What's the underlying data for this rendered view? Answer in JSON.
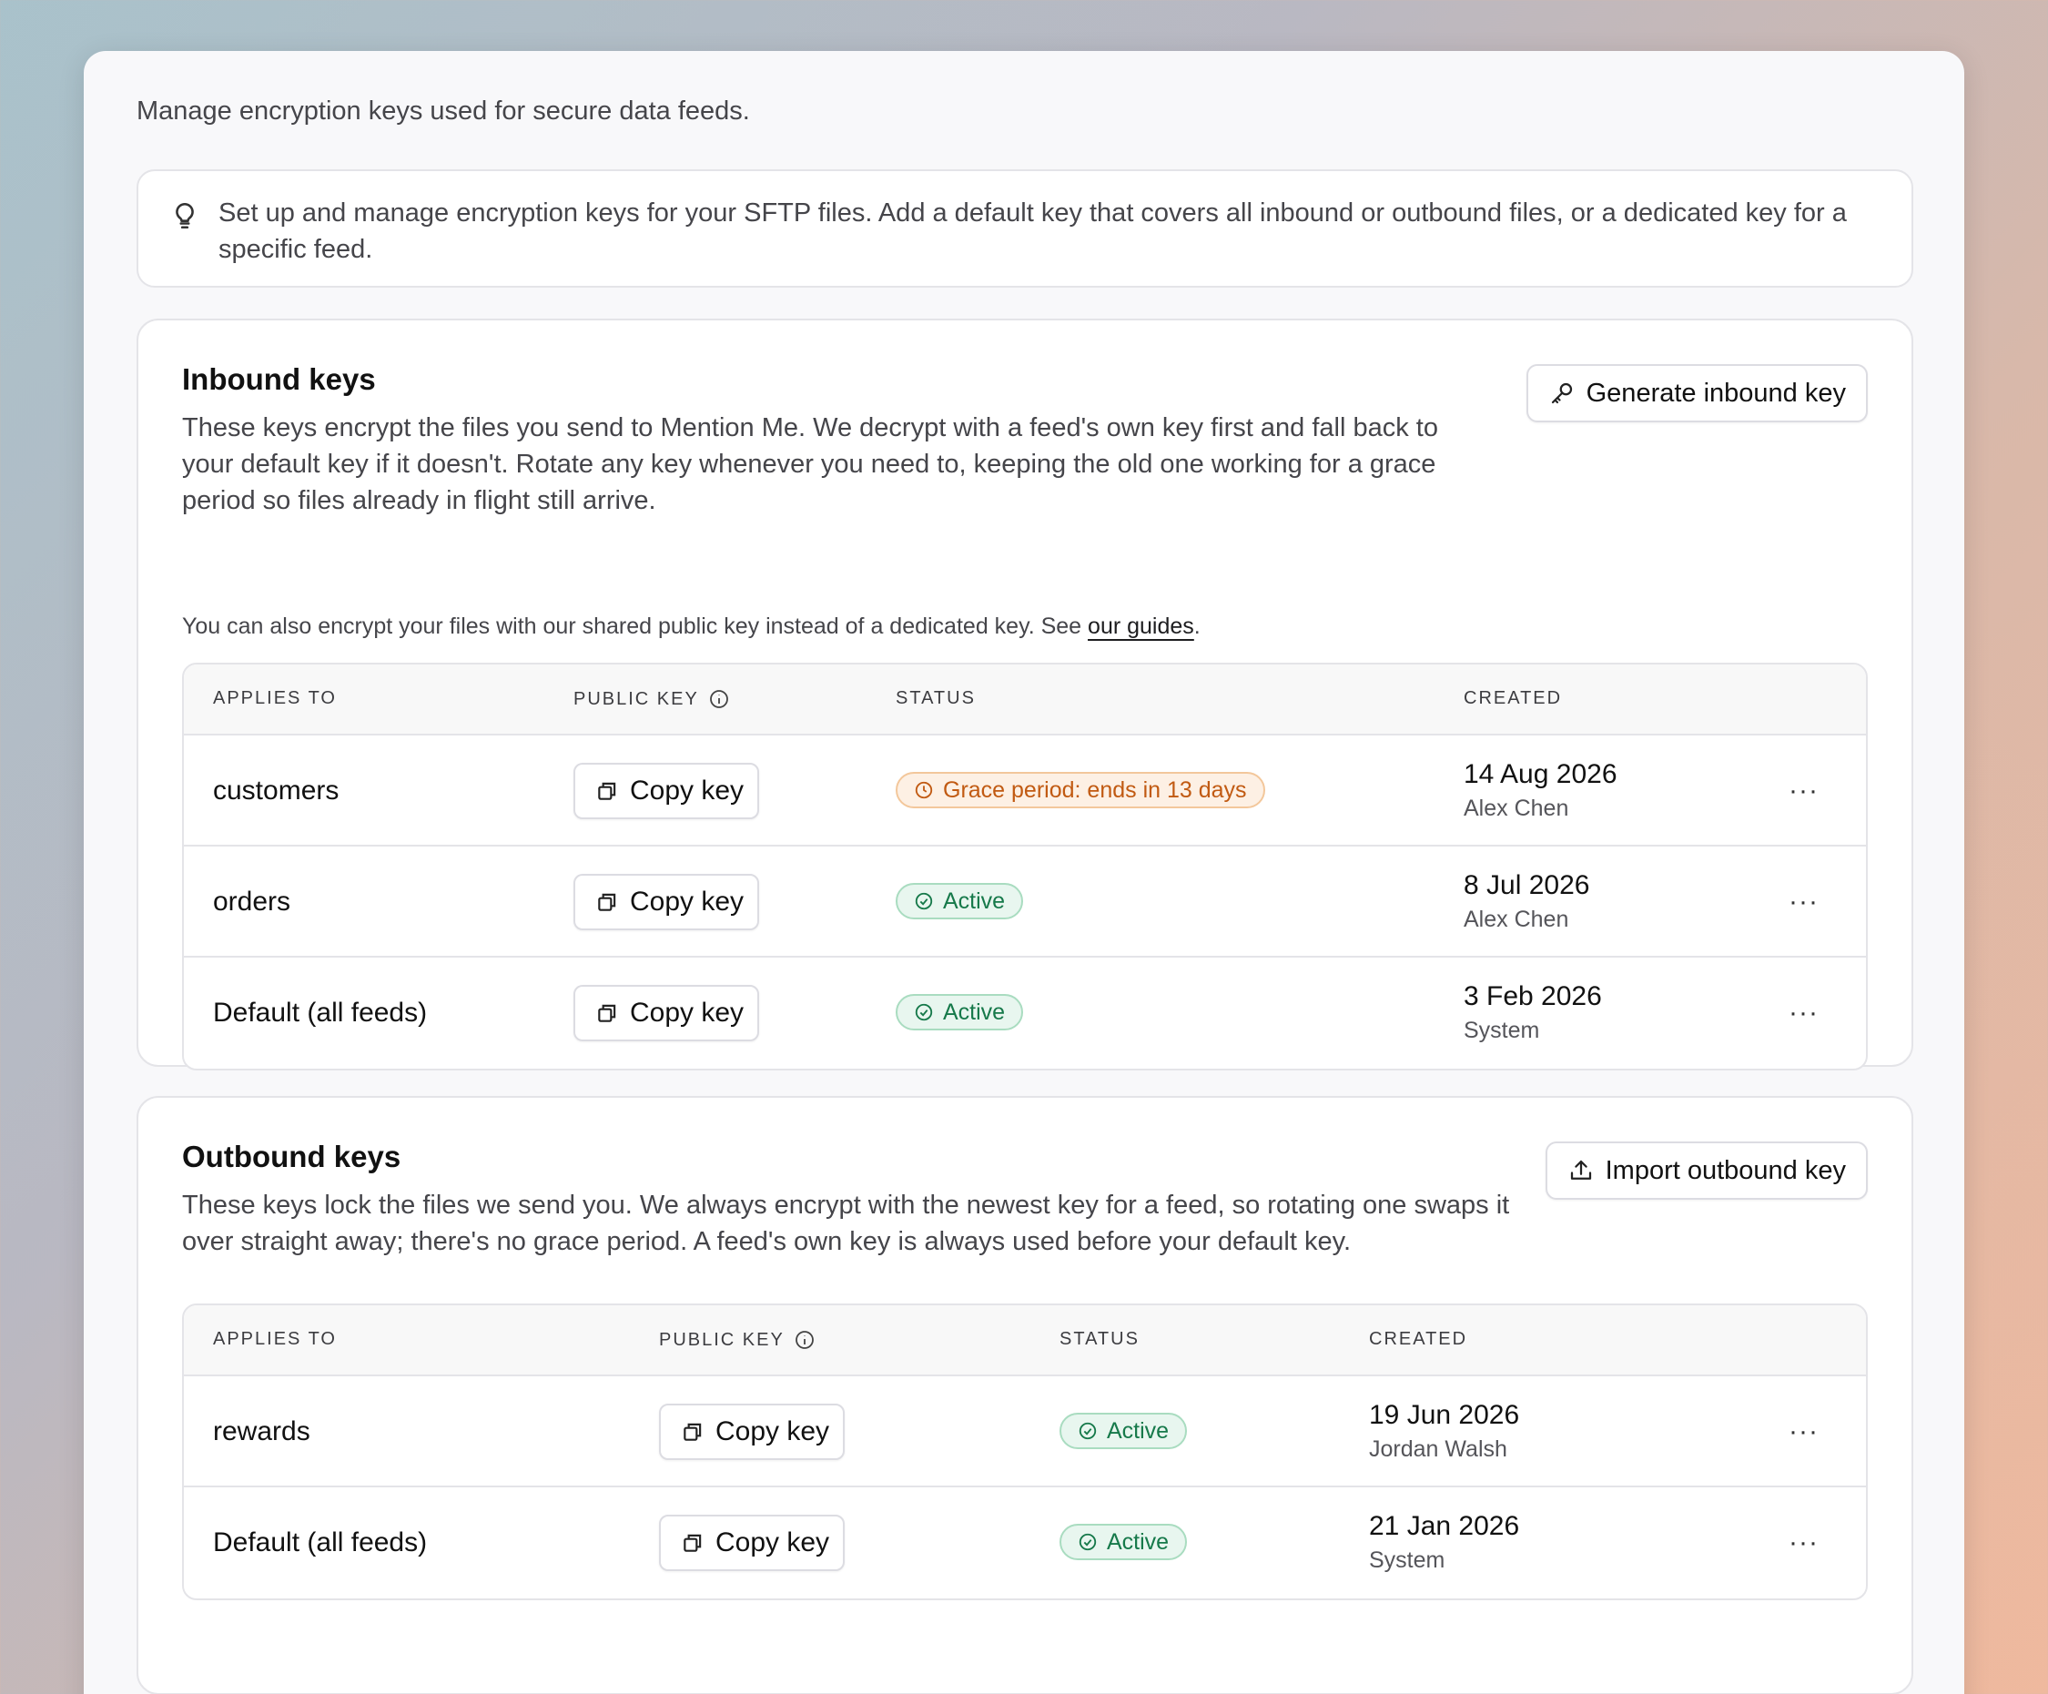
{
  "intro": "Manage encryption keys used for secure data feeds.",
  "tip": "Set up and manage encryption keys for your SFTP files. Add a default key that covers all inbound or outbound files, or a dedicated key for a specific feed.",
  "inbound": {
    "title": "Inbound keys",
    "description": "These keys encrypt the files you send to Mention Me. We decrypt with a feed's own key first and fall back to your default key if it doesn't. Rotate any key whenever you need to, keeping the old one working for a grace period so files already in flight still arrive.",
    "note_prefix": "You can also encrypt your files with our shared public key instead of a dedicated key. See ",
    "note_link": "our guides",
    "note_suffix": ".",
    "button": "Generate inbound key",
    "headers": {
      "applies_to": "APPLIES TO",
      "public_key": "PUBLIC KEY",
      "status": "STATUS",
      "created": "CREATED"
    },
    "rows": [
      {
        "name": "customers",
        "copy": "Copy key",
        "status": "Grace period: ends in 13 days",
        "date": "14 Aug 2026",
        "by": "Alex Chen",
        "more": "···"
      },
      {
        "name": "orders",
        "copy": "Copy key",
        "status": "Active",
        "date": "8 Jul 2026",
        "by": "Alex Chen",
        "more": "···"
      },
      {
        "name": "Default (all feeds)",
        "copy": "Copy key",
        "status": "Active",
        "date": "3 Feb 2026",
        "by": "System",
        "more": "···"
      }
    ]
  },
  "outbound": {
    "title": "Outbound keys",
    "description": "These keys lock the files we send you. We always encrypt with the newest key for a feed, so rotating one swaps it over straight away; there's no grace period. A feed's own key is always used before your default key.",
    "button": "Import outbound key",
    "headers": {
      "applies_to": "APPLIES TO",
      "public_key": "PUBLIC KEY",
      "status": "STATUS",
      "created": "CREATED"
    },
    "rows": [
      {
        "name": "rewards",
        "copy": "Copy key",
        "status": "Active",
        "date": "19 Jun 2026",
        "by": "Jordan Walsh",
        "more": "···"
      },
      {
        "name": "Default (all feeds)",
        "copy": "Copy key",
        "status": "Active",
        "date": "21 Jan 2026",
        "by": "System",
        "more": "···"
      }
    ]
  },
  "colors": {
    "active": "#16794a",
    "grace": "#c15a12",
    "card": "#f8f8fa"
  },
  "icons": {
    "tip": "lightbulb-icon",
    "generate": "key-icon",
    "import": "upload-icon",
    "copy": "copy-icon",
    "info": "info-icon",
    "active": "check-circle-icon",
    "grace": "clock-icon"
  }
}
